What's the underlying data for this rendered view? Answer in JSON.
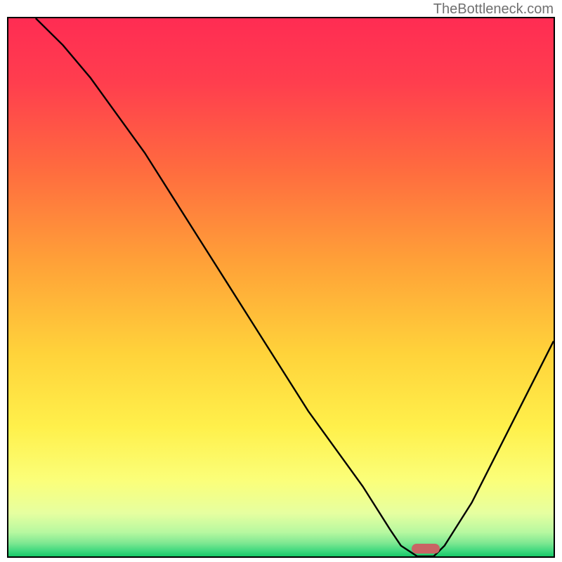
{
  "watermark": "TheBottleneck.com",
  "chart_data": {
    "type": "line",
    "title": "",
    "xlabel": "",
    "ylabel": "",
    "xlim": [
      0,
      100
    ],
    "ylim": [
      0,
      100
    ],
    "grid": false,
    "background": "vertical-gradient red→orange→yellow→green",
    "series": [
      {
        "name": "bottleneck-curve",
        "x": [
          5,
          10,
          15,
          20,
          25,
          30,
          35,
          40,
          45,
          50,
          55,
          60,
          65,
          70,
          72,
          75,
          78,
          80,
          85,
          90,
          95,
          100
        ],
        "y": [
          100,
          95,
          89,
          82,
          75,
          67,
          59,
          51,
          43,
          35,
          27,
          20,
          13,
          5,
          2,
          0,
          0,
          2,
          10,
          20,
          30,
          40
        ]
      }
    ],
    "marker": {
      "x": 76.5,
      "y": 1.5,
      "color": "#c96464"
    },
    "gradient_stops": [
      {
        "offset": 0.0,
        "color": "#ff2c53"
      },
      {
        "offset": 0.12,
        "color": "#ff3e4e"
      },
      {
        "offset": 0.28,
        "color": "#ff6b3f"
      },
      {
        "offset": 0.45,
        "color": "#ffa038"
      },
      {
        "offset": 0.62,
        "color": "#ffd23a"
      },
      {
        "offset": 0.76,
        "color": "#fff04b"
      },
      {
        "offset": 0.86,
        "color": "#fbff7a"
      },
      {
        "offset": 0.92,
        "color": "#e6ffa0"
      },
      {
        "offset": 0.955,
        "color": "#b7f8a0"
      },
      {
        "offset": 0.975,
        "color": "#7fe892"
      },
      {
        "offset": 0.99,
        "color": "#3fd87e"
      },
      {
        "offset": 1.0,
        "color": "#18c967"
      }
    ]
  }
}
